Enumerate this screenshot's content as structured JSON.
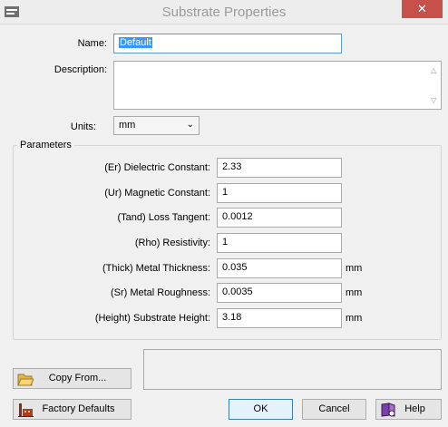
{
  "window": {
    "title": "Substrate Properties",
    "close_label": "✕"
  },
  "form": {
    "name_label": "Name:",
    "name_value": "Default",
    "description_label": "Description:",
    "description_value": "",
    "units_label": "Units:",
    "units_value": "mm"
  },
  "parameters": {
    "title": "Parameters",
    "rows": [
      {
        "label": "(Er) Dielectric Constant:",
        "value": "2.33",
        "unit": ""
      },
      {
        "label": "(Ur) Magnetic Constant:",
        "value": "1",
        "unit": ""
      },
      {
        "label": "(Tand) Loss Tangent:",
        "value": "0.0012",
        "unit": ""
      },
      {
        "label": "(Rho) Resistivity:",
        "value": "1",
        "unit": ""
      },
      {
        "label": "(Thick) Metal Thickness:",
        "value": "0.035",
        "unit": "mm"
      },
      {
        "label": "(Sr) Metal Roughness:",
        "value": "0.0035",
        "unit": "mm"
      },
      {
        "label": "(Height) Substrate Height:",
        "value": "3.18",
        "unit": "mm"
      }
    ]
  },
  "buttons": {
    "copy_from": "Copy From...",
    "factory_defaults": "Factory Defaults",
    "ok": "OK",
    "cancel": "Cancel",
    "help": "Help"
  },
  "icons": {
    "title_icon": "window-menu-icon",
    "copy_from_icon": "folder-open-icon",
    "factory_defaults_icon": "factory-icon",
    "help_icon": "help-book-icon"
  }
}
